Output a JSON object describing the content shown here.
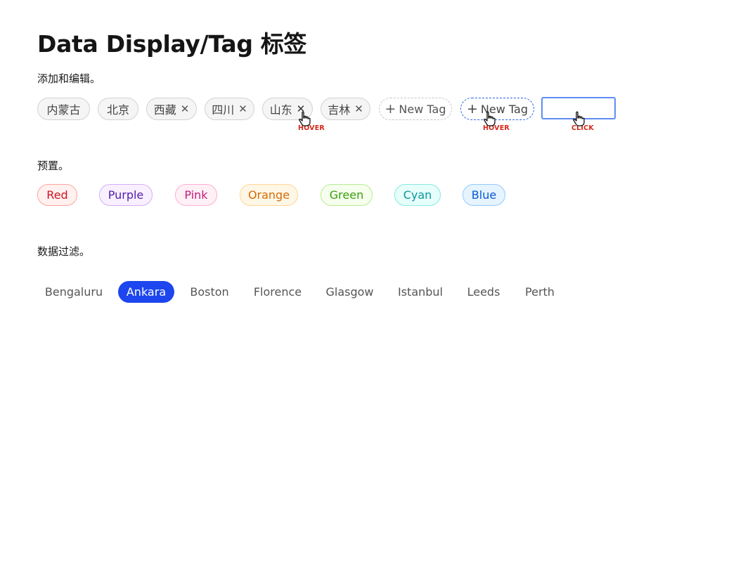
{
  "page": {
    "title": "Data Display/Tag 标签"
  },
  "edit_section": {
    "label": "添加和编辑。",
    "tags": [
      {
        "text": "内蒙古",
        "closable": false
      },
      {
        "text": "北京",
        "closable": false
      },
      {
        "text": "西藏",
        "closable": true
      },
      {
        "text": "四川",
        "closable": true
      },
      {
        "text": "山东",
        "closable": true
      },
      {
        "text": "吉林",
        "closable": true
      }
    ],
    "close_glyph": "✕",
    "add_plus": "+",
    "new_tag_label": "New Tag",
    "new_tag_hover_label": "New Tag",
    "new_tag_input_value": "",
    "hints": {
      "close_hover": "HOVER",
      "new_tag_hover": "HOVER",
      "input_click": "CLICK"
    }
  },
  "preset_section": {
    "label": "预置。",
    "tags": [
      {
        "text": "Red",
        "color": "#cf1322",
        "bg": "#fff1f0",
        "border": "#ffa39e"
      },
      {
        "text": "Purple",
        "color": "#531dab",
        "bg": "#f9f0ff",
        "border": "#d3adf7"
      },
      {
        "text": "Pink",
        "color": "#c41d7f",
        "bg": "#fff0f6",
        "border": "#ffadd2"
      },
      {
        "text": "Orange",
        "color": "#d46b08",
        "bg": "#fff7e6",
        "border": "#ffd591"
      },
      {
        "text": "Green",
        "color": "#389e0d",
        "bg": "#f6ffed",
        "border": "#b7eb8f"
      },
      {
        "text": "Cyan",
        "color": "#08979c",
        "bg": "#e6fffb",
        "border": "#87e8de"
      },
      {
        "text": "Blue",
        "color": "#0958d9",
        "bg": "#e6f4ff",
        "border": "#91caff"
      }
    ]
  },
  "filter_section": {
    "label": "数据过滤。",
    "options": [
      "Bengaluru",
      "Ankara",
      "Boston",
      "Florence",
      "Glasgow",
      "Istanbul",
      "Leeds",
      "Perth"
    ],
    "selected": "Ankara"
  },
  "colors": {
    "accent": "#1d46ee",
    "hint_red": "#d6281b",
    "focus_border": "#5e8cf2"
  }
}
